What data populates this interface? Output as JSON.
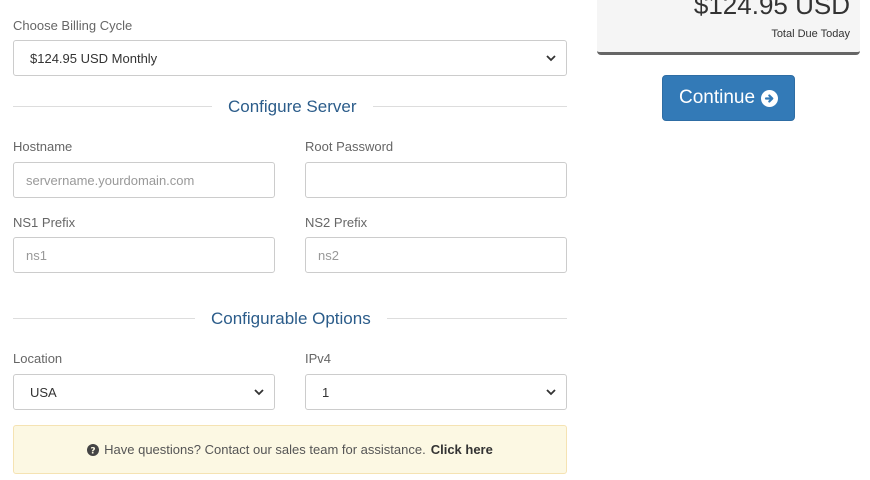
{
  "billing": {
    "label": "Choose Billing Cycle",
    "selected": "$124.95 USD Monthly"
  },
  "configure_server": {
    "title": "Configure Server",
    "hostname": {
      "label": "Hostname",
      "placeholder": "servername.yourdomain.com"
    },
    "root_password": {
      "label": "Root Password",
      "value": ""
    },
    "ns1": {
      "label": "NS1 Prefix",
      "placeholder": "ns1"
    },
    "ns2": {
      "label": "NS2 Prefix",
      "placeholder": "ns2"
    }
  },
  "configurable_options": {
    "title": "Configurable Options",
    "location": {
      "label": "Location",
      "selected": "USA"
    },
    "ipv4": {
      "label": "IPv4",
      "selected": "1"
    }
  },
  "summary": {
    "amount": "$124.95 USD",
    "subtitle": "Total Due Today"
  },
  "continue_button": {
    "label": "Continue",
    "icon": "arrow-circle-right-icon"
  },
  "help_alert": {
    "icon": "question-circle-icon",
    "text": "Have questions? Contact our sales team for assistance.",
    "link": "Click here"
  },
  "colors": {
    "primary": "#337ab7",
    "section_title": "#2b5c8a",
    "alert_bg": "#fcf8e3"
  }
}
